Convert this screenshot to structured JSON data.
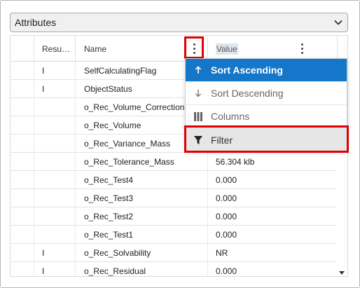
{
  "attributes_select": {
    "value": "Attributes"
  },
  "columns": {
    "result": "Resu…",
    "name": "Name",
    "value": "Value"
  },
  "rows": [
    {
      "result": "I",
      "name": "SelfCalculatingFlag",
      "value": ""
    },
    {
      "result": "I",
      "name": "ObjectStatus",
      "value": ""
    },
    {
      "result": "",
      "name": "o_Rec_Volume_Correction",
      "value": ""
    },
    {
      "result": "",
      "name": "o_Rec_Volume",
      "value": ""
    },
    {
      "result": "",
      "name": "o_Rec_Variance_Mass",
      "value": ""
    },
    {
      "result": "",
      "name": "o_Rec_Tolerance_Mass",
      "value": "56.304 klb"
    },
    {
      "result": "",
      "name": "o_Rec_Test4",
      "value": "0.000"
    },
    {
      "result": "",
      "name": "o_Rec_Test3",
      "value": "0.000"
    },
    {
      "result": "",
      "name": "o_Rec_Test2",
      "value": "0.000"
    },
    {
      "result": "",
      "name": "o_Rec_Test1",
      "value": "0.000"
    },
    {
      "result": "I",
      "name": "o_Rec_Solvability",
      "value": "NR"
    },
    {
      "result": "I",
      "name": "o_Rec_Residual",
      "value": "0.000"
    }
  ],
  "column_menu": {
    "items": [
      {
        "label": "Sort Ascending",
        "icon": "arrow-up-icon"
      },
      {
        "label": "Sort Descending",
        "icon": "arrow-down-icon"
      },
      {
        "label": "Columns",
        "icon": "columns-icon"
      },
      {
        "label": "Filter",
        "icon": "filter-icon"
      }
    ]
  },
  "colors": {
    "highlight": "#e00000",
    "menu_active": "#1477c9"
  }
}
